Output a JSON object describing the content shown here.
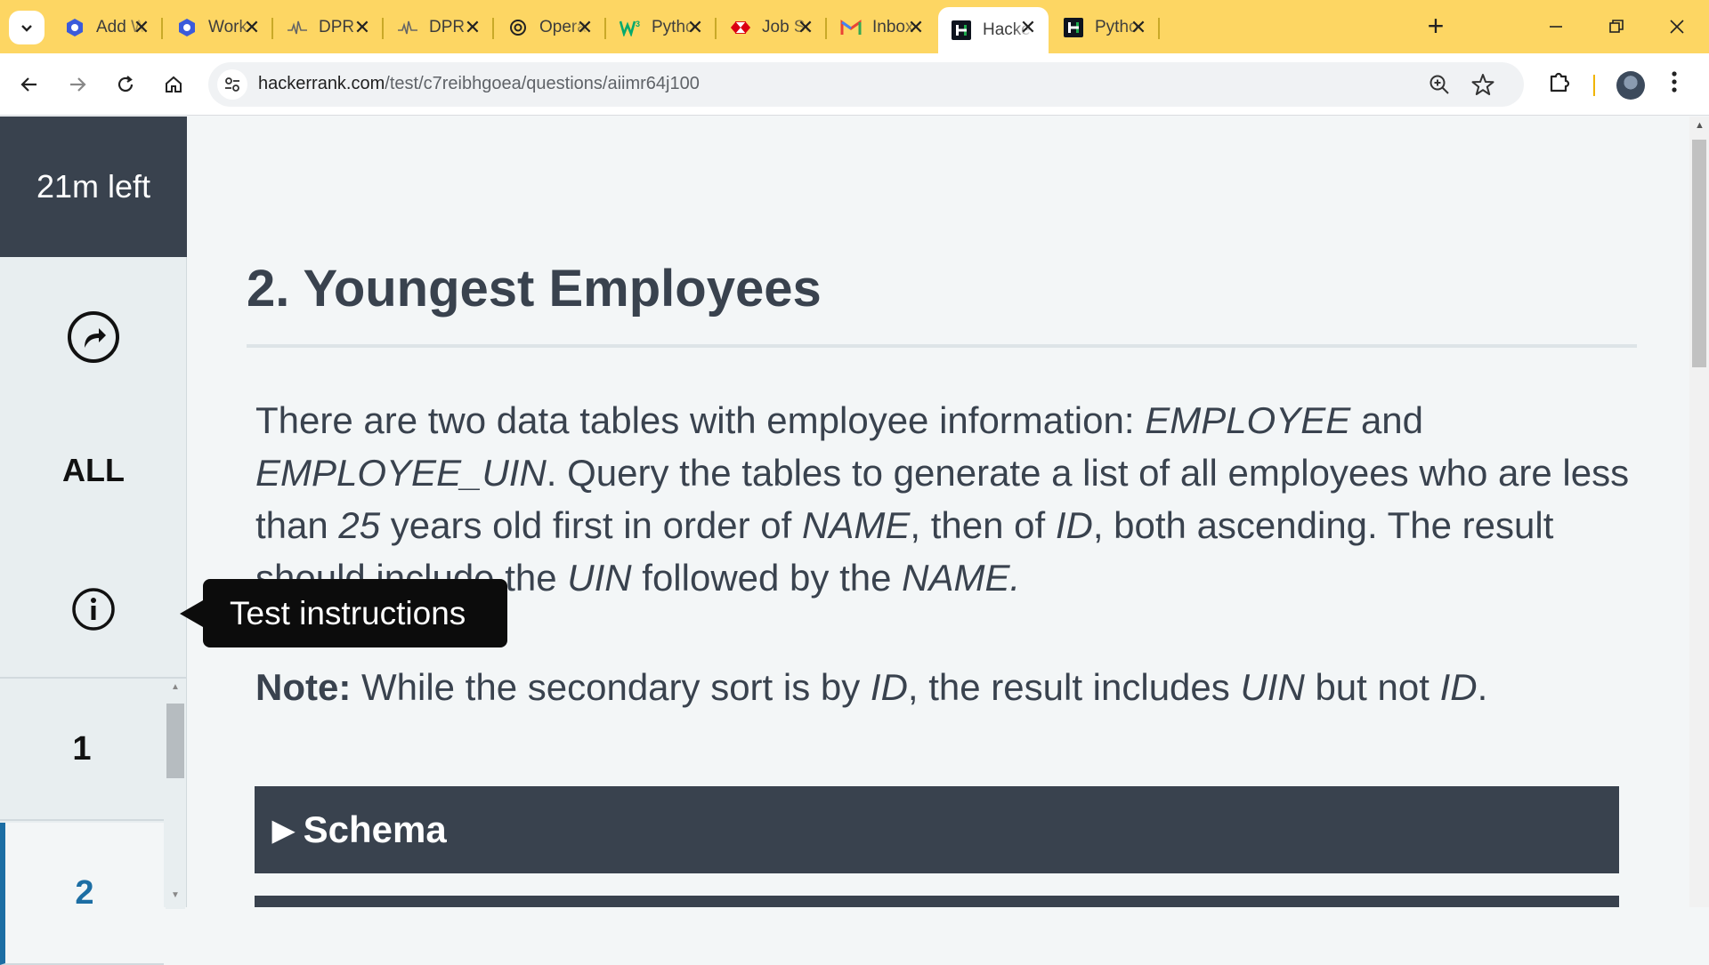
{
  "browser": {
    "tabs": [
      {
        "title": "Add W",
        "icon": "gear-hex-icon",
        "color": "#3b5bdb"
      },
      {
        "title": "Work",
        "icon": "gear-hex-icon",
        "color": "#3b5bdb"
      },
      {
        "title": "DPR -",
        "icon": "pulse-icon",
        "color": "#666666"
      },
      {
        "title": "DPR -",
        "icon": "pulse-icon",
        "color": "#666666"
      },
      {
        "title": "Opera",
        "icon": "openai-icon",
        "color": "#222222"
      },
      {
        "title": "Pytho",
        "icon": "w3schools-icon",
        "color": "#04aa6d"
      },
      {
        "title": "Job Sc",
        "icon": "hsbc-icon",
        "color": "#db0011"
      },
      {
        "title": "Inbox",
        "icon": "gmail-icon",
        "color": "#ea4335"
      },
      {
        "title": "Hacke",
        "icon": "hackerrank-icon",
        "color": "#1ba94c",
        "active": true
      },
      {
        "title": "Pytho",
        "icon": "hackerrank-icon",
        "color": "#1ba94c"
      }
    ],
    "url_host": "hackerrank.com",
    "url_path": "/test/c7reibhgoea/questions/aiimr64j100"
  },
  "sidebar": {
    "timer": "21m left",
    "all_label": "ALL",
    "questions": [
      "1",
      "2"
    ],
    "current_question": "2"
  },
  "tooltip": "Test instructions",
  "question": {
    "title": "2. Youngest Employees",
    "body": [
      {
        "t": "There are two data tables with employee information: "
      },
      {
        "t": "EMPLOYEE",
        "i": true
      },
      {
        "t": " and "
      },
      {
        "t": "EMPLOYEE_UIN",
        "i": true
      },
      {
        "t": ". Query the tables to generate a list of all employees who are less than "
      },
      {
        "t": "25",
        "i": true
      },
      {
        "t": " years old first in order of "
      },
      {
        "t": "NAME",
        "i": true
      },
      {
        "t": ", then of "
      },
      {
        "t": "ID",
        "i": true
      },
      {
        "t": ", both ascending.  The result should include the "
      },
      {
        "t": "UIN",
        "i": true
      },
      {
        "t": " followed by the "
      },
      {
        "t": "NAME.",
        "i": true
      }
    ],
    "note_label": "Note:",
    "note": [
      {
        "t": "  While the secondary sort is by "
      },
      {
        "t": "ID",
        "i": true
      },
      {
        "t": ", the result includes "
      },
      {
        "t": "UIN",
        "i": true
      },
      {
        "t": " but not "
      },
      {
        "t": "ID",
        "i": true
      },
      {
        "t": "."
      }
    ],
    "schema_label": "Schema"
  },
  "colors": {
    "tabbar": "#fdd663",
    "panel_dark": "#39424e",
    "accent": "#1c6ea4"
  }
}
